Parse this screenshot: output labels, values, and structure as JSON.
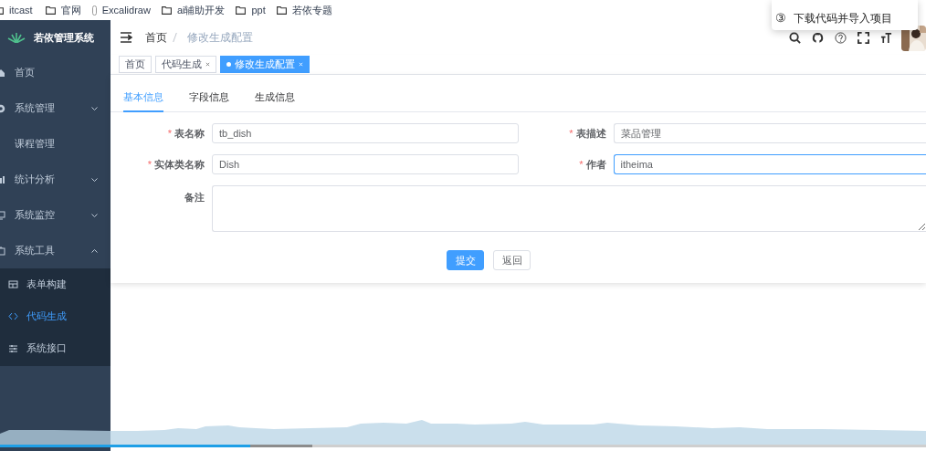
{
  "bookmarks": [
    {
      "label": "itcast",
      "kind": "folder"
    },
    {
      "label": "官网",
      "kind": "folder"
    },
    {
      "label": "Excalidraw",
      "kind": "link"
    },
    {
      "label": "ai辅助开发",
      "kind": "folder"
    },
    {
      "label": "ppt",
      "kind": "folder"
    },
    {
      "label": "若依专题",
      "kind": "folder"
    }
  ],
  "popup": {
    "items": [
      {
        "marker": "③",
        "text": "下载代码并导入项目"
      }
    ]
  },
  "sidebar": {
    "title": "若依管理系统",
    "items": [
      {
        "label": "首页",
        "has_children": false
      },
      {
        "label": "系统管理",
        "expanded": false,
        "has_children": true
      },
      {
        "label": "课程管理",
        "has_children": false
      },
      {
        "label": "统计分析",
        "expanded": false,
        "has_children": true
      },
      {
        "label": "系统监控",
        "expanded": false,
        "has_children": true
      },
      {
        "label": "系统工具",
        "expanded": true,
        "has_children": true,
        "children": [
          {
            "label": "表单构建",
            "selected": false
          },
          {
            "label": "代码生成",
            "selected": true
          },
          {
            "label": "系统接口",
            "selected": false
          }
        ]
      }
    ]
  },
  "breadcrumb": [
    "首页",
    "修改生成配置"
  ],
  "tags": [
    {
      "label": "首页",
      "selected": false,
      "closable": false
    },
    {
      "label": "代码生成",
      "selected": false,
      "closable": true
    },
    {
      "label": "修改生成配置",
      "selected": true,
      "closable": true
    }
  ],
  "form_tabs": [
    {
      "label": "基本信息",
      "selected": true
    },
    {
      "label": "字段信息",
      "selected": false
    },
    {
      "label": "生成信息",
      "selected": false
    }
  ],
  "fields": [
    {
      "label": "表名称",
      "required_mark": "*",
      "value": "tb_dish",
      "focused": false
    },
    {
      "label": "表描述",
      "required_mark": "*",
      "value": "菜品管理",
      "focused": false
    },
    {
      "label": "实体类名称",
      "required_mark": "*",
      "value": "Dish",
      "focused": false
    },
    {
      "label": "作者",
      "required_mark": "*",
      "value": "itheima",
      "focused": true
    }
  ],
  "remark": {
    "label": "备注"
  },
  "buttons": [
    {
      "label": "提交",
      "kind": "primary"
    },
    {
      "label": "返回",
      "kind": "default"
    }
  ],
  "player": {
    "level": 0.27
  }
}
